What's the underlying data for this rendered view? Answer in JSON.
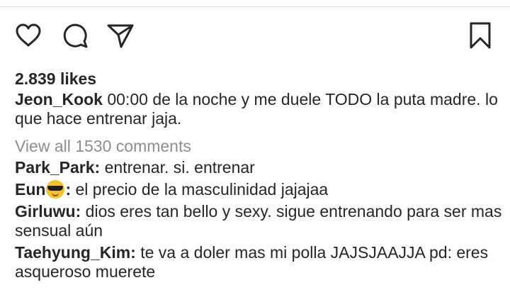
{
  "icons": {
    "like": "heart-icon",
    "comment": "comment-bubble-icon",
    "share": "paper-plane-icon",
    "save": "bookmark-icon"
  },
  "colors": {
    "text": "#262626",
    "muted": "#8e8e8e",
    "divider": "#e3e3e3",
    "emoji": "#f7c227"
  },
  "post": {
    "likes": "2.839 likes",
    "author": "Jeon_Kook",
    "caption": " 00:00 de la noche y me duele TODO la puta madre. lo que hace entrenar jaja.",
    "view_all": "View all 1530 comments"
  },
  "comments": [
    {
      "user": "Park_Park:",
      "text": " entrenar. si. entrenar"
    },
    {
      "user": "Eun",
      "emoji": "smiling-face-with-sunglasses-emoji",
      "user_suffix": ":",
      "text": " el precio de la masculinidad jajajaa"
    },
    {
      "user": "Girluwu:",
      "text": " dios eres tan bello y sexy. sigue entrenando para ser mas sensual aún"
    },
    {
      "user": "Taehyung_Kim:",
      "text": " te va a doler mas mi polla JAJSJAAJJA pd: eres asqueroso muerete"
    }
  ]
}
